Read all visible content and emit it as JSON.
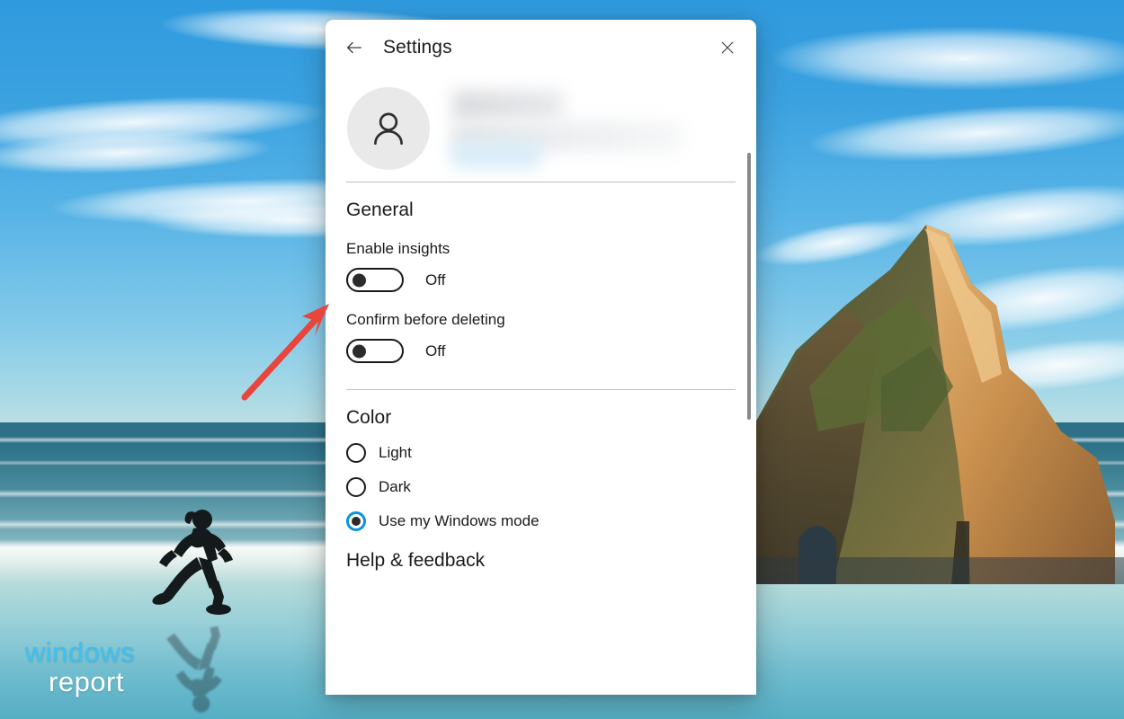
{
  "window": {
    "title": "Settings",
    "back_icon": "arrow-left-icon",
    "close_icon": "close-icon"
  },
  "account": {
    "avatar_icon": "person-icon",
    "name_redacted": "",
    "email_redacted": ""
  },
  "sections": {
    "general": {
      "title": "General",
      "settings": [
        {
          "label": "Enable insights",
          "state": "Off",
          "on": false
        },
        {
          "label": "Confirm before deleting",
          "state": "Off",
          "on": false
        }
      ]
    },
    "color": {
      "title": "Color",
      "options": [
        {
          "label": "Light",
          "selected": false
        },
        {
          "label": "Dark",
          "selected": false
        },
        {
          "label": "Use my Windows mode",
          "selected": true
        }
      ]
    },
    "help": {
      "title": "Help & feedback"
    }
  },
  "scrollbar": {
    "name": "vertical-scrollbar"
  },
  "annotation": {
    "arrow_color": "#e8453c",
    "points_to": "Enable insights toggle"
  },
  "watermark": {
    "line1": "windows",
    "line2": "report",
    "color1": "#3fc0f0",
    "color2": "#ffffff"
  },
  "colors": {
    "accent": "#0a93db",
    "dialog_bg": "#ffffff",
    "text": "#1a1a1a",
    "avatar_bg": "#e9e9e9",
    "divider": "#9a9a9a"
  }
}
